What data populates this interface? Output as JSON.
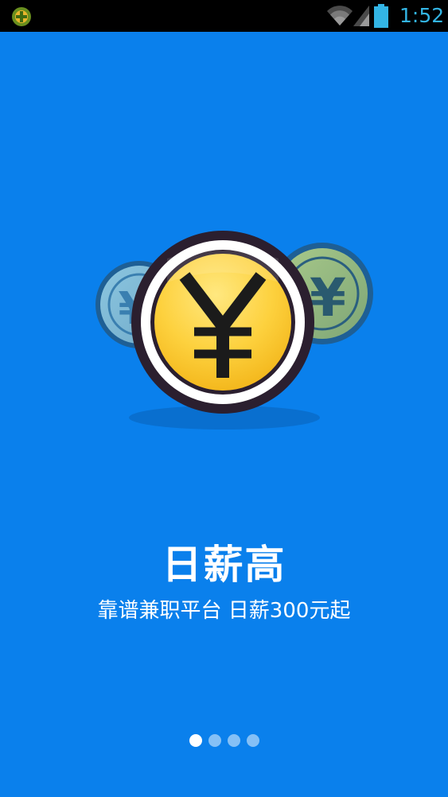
{
  "status_bar": {
    "time": "1:52",
    "icons": [
      "app-notification-icon",
      "wifi-icon",
      "cell-signal-icon",
      "battery-icon"
    ]
  },
  "slide": {
    "illustration": "coin-yuan-icon",
    "currency_symbol": "¥",
    "title": "日薪高",
    "subtitle": "靠谱兼职平台 日薪300元起"
  },
  "pager": {
    "total": 4,
    "active_index": 0
  },
  "colors": {
    "background": "#0a80ec",
    "status_bar": "#000000",
    "clock": "#33b5e5",
    "coin_gold": "#fdd13e",
    "coin_outline": "#2b1f2f"
  }
}
